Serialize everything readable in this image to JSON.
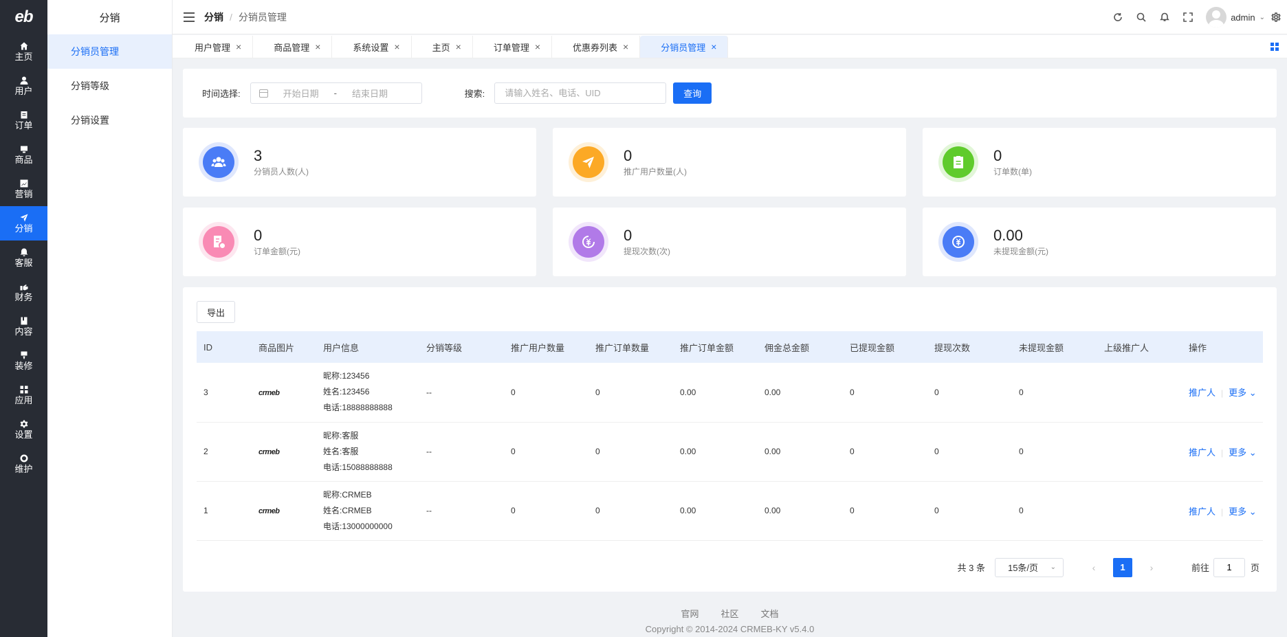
{
  "rail": {
    "logo": "eb",
    "items": [
      {
        "label": "主页",
        "icon": "home-icon"
      },
      {
        "label": "用户",
        "icon": "user-icon"
      },
      {
        "label": "订单",
        "icon": "order-icon"
      },
      {
        "label": "商品",
        "icon": "product-icon"
      },
      {
        "label": "营销",
        "icon": "marketing-icon"
      },
      {
        "label": "分销",
        "icon": "send-icon"
      },
      {
        "label": "客服",
        "icon": "bell-icon"
      },
      {
        "label": "财务",
        "icon": "finance-icon"
      },
      {
        "label": "内容",
        "icon": "book-icon"
      },
      {
        "label": "装修",
        "icon": "brush-icon"
      },
      {
        "label": "应用",
        "icon": "apps-icon"
      },
      {
        "label": "设置",
        "icon": "gear-icon"
      },
      {
        "label": "维护",
        "icon": "maintenance-icon"
      }
    ],
    "active_index": 5
  },
  "submenu": {
    "title": "分销",
    "items": [
      "分销员管理",
      "分销等级",
      "分销设置"
    ]
  },
  "header": {
    "crumb1": "分销",
    "crumb_sep": "/",
    "crumb2": "分销员管理",
    "user": "admin"
  },
  "tabs": [
    "用户管理",
    "商品管理",
    "系统设置",
    "主页",
    "订单管理",
    "优惠券列表",
    "分销员管理"
  ],
  "filter": {
    "time_label": "时间选择:",
    "start_placeholder": "开始日期",
    "dash": "-",
    "end_placeholder": "结束日期",
    "search_label": "搜索:",
    "search_placeholder": "请输入姓名、电话、UID",
    "query": "查询"
  },
  "stats": [
    {
      "value": "3",
      "label": "分销员人数(人)",
      "color": "#4a7cf6",
      "ring": "#dfe7fd",
      "icon": "users-icon"
    },
    {
      "value": "0",
      "label": "推广用户数量(人)",
      "color": "#fca925",
      "ring": "#fef0d8",
      "icon": "send-icon"
    },
    {
      "value": "0",
      "label": "订单数(单)",
      "color": "#5fcb2c",
      "ring": "#e2f6d8",
      "icon": "clipboard-icon"
    },
    {
      "value": "0",
      "label": "订单金额(元)",
      "color": "#f98ab4",
      "ring": "#fde6ef",
      "icon": "invoice-icon"
    },
    {
      "value": "0",
      "label": "提现次数(次)",
      "color": "#b17ae8",
      "ring": "#f1e6fb",
      "icon": "yuan-icon"
    },
    {
      "value": "0.00",
      "label": "未提现金额(元)",
      "color": "#4a7cf6",
      "ring": "#dfe7fd",
      "icon": "yuan-cycle-icon"
    }
  ],
  "table": {
    "export": "导出",
    "columns": [
      "ID",
      "商品图片",
      "用户信息",
      "分销等级",
      "推广用户数量",
      "推广订单数量",
      "推广订单金额",
      "佣金总金额",
      "已提现金额",
      "提现次数",
      "未提现金额",
      "上级推广人",
      "操作"
    ],
    "rows": [
      {
        "id": "3",
        "img": "crmeb",
        "nick": "昵称:123456",
        "name": "姓名:123456",
        "phone": "电话:18888888888",
        "level": "--",
        "users": "0",
        "orders": "0",
        "amount": "0.00",
        "commission": "0.00",
        "withdrawn": "0",
        "times": "0",
        "unwithdrawn": "0",
        "superior": "",
        "op1": "推广人",
        "op2": "更多"
      },
      {
        "id": "2",
        "img": "crmeb",
        "nick": "昵称:客服",
        "name": "姓名:客服",
        "phone": "电话:15088888888",
        "level": "--",
        "users": "0",
        "orders": "0",
        "amount": "0.00",
        "commission": "0.00",
        "withdrawn": "0",
        "times": "0",
        "unwithdrawn": "0",
        "superior": "",
        "op1": "推广人",
        "op2": "更多"
      },
      {
        "id": "1",
        "img": "crmeb",
        "nick": "昵称:CRMEB",
        "name": "姓名:CRMEB",
        "phone": "电话:13000000000",
        "level": "--",
        "users": "0",
        "orders": "0",
        "amount": "0.00",
        "commission": "0.00",
        "withdrawn": "0",
        "times": "0",
        "unwithdrawn": "0",
        "superior": "",
        "op1": "推广人",
        "op2": "更多"
      }
    ]
  },
  "pager": {
    "total": "共 3 条",
    "size": "15条/页",
    "current": "1",
    "goto": "前往",
    "jump_value": "1",
    "unit": "页"
  },
  "footer": {
    "links": [
      "官网",
      "社区",
      "文档"
    ],
    "copyright": "Copyright © 2014-2024 CRMEB-KY v5.4.0"
  }
}
